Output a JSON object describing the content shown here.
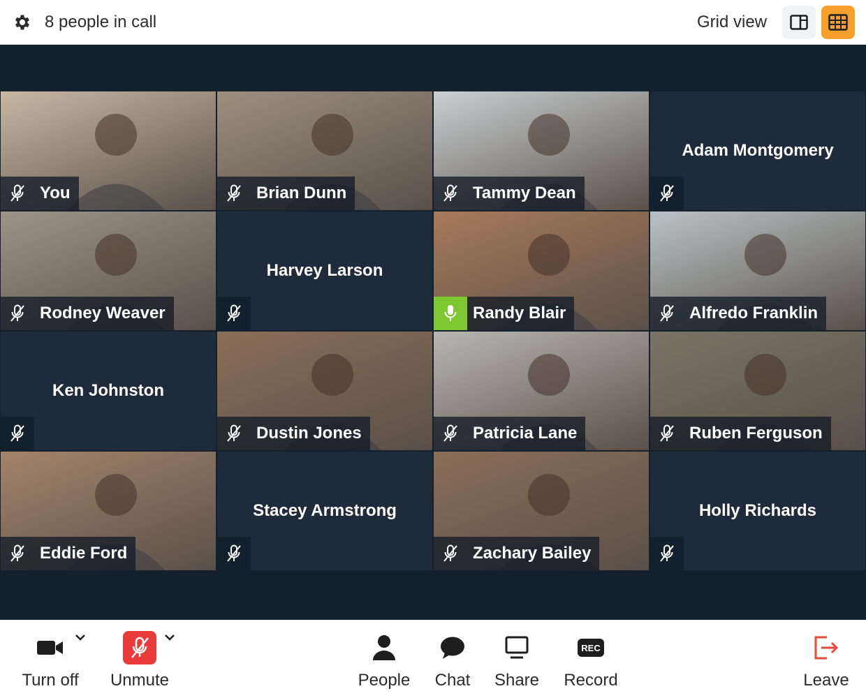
{
  "header": {
    "people_count": "8 people in call",
    "view_label": "Grid view"
  },
  "tiles": [
    {
      "name": "You",
      "video": true,
      "mic": "muted",
      "bg": "#c7b7a4"
    },
    {
      "name": "Brian Dunn",
      "video": true,
      "mic": "muted",
      "bg": "#9c8f80"
    },
    {
      "name": "Tammy Dean",
      "video": true,
      "mic": "muted",
      "bg": "#c9cfd2"
    },
    {
      "name": "Adam Montgomery",
      "video": false,
      "mic": "muted"
    },
    {
      "name": "Rodney Weaver",
      "video": true,
      "mic": "muted",
      "bg": "#9b9487"
    },
    {
      "name": "Harvey Larson",
      "video": false,
      "mic": "muted"
    },
    {
      "name": "Randy Blair",
      "video": true,
      "mic": "active",
      "bg": "#a87a5a"
    },
    {
      "name": "Alfredo Franklin",
      "video": true,
      "mic": "muted",
      "bg": "#b9c3c6"
    },
    {
      "name": "Ken Johnston",
      "video": false,
      "mic": "muted"
    },
    {
      "name": "Dustin Jones",
      "video": true,
      "mic": "muted",
      "bg": "#8b6e58"
    },
    {
      "name": "Patricia Lane",
      "video": true,
      "mic": "muted",
      "bg": "#b8b6b0"
    },
    {
      "name": "Ruben Ferguson",
      "video": true,
      "mic": "muted",
      "bg": "#7a7466"
    },
    {
      "name": "Eddie Ford",
      "video": true,
      "mic": "muted",
      "bg": "#a3846a"
    },
    {
      "name": "Stacey Armstrong",
      "video": false,
      "mic": "muted"
    },
    {
      "name": "Zachary Bailey",
      "video": true,
      "mic": "muted",
      "bg": "#8b6e58"
    },
    {
      "name": "Holly Richards",
      "video": false,
      "mic": "muted"
    }
  ],
  "toolbar": {
    "camera_label": "Turn off",
    "unmute_label": "Unmute",
    "people_label": "People",
    "chat_label": "Chat",
    "share_label": "Share",
    "record_label": "Record",
    "record_badge": "REC",
    "leave_label": "Leave"
  },
  "colors": {
    "accent": "#f5a02a",
    "stage": "#13202d",
    "tile": "#1e2b3a",
    "mic_active": "#7ec730",
    "unmute": "#ea3b3b",
    "leave": "#e64a3b"
  }
}
